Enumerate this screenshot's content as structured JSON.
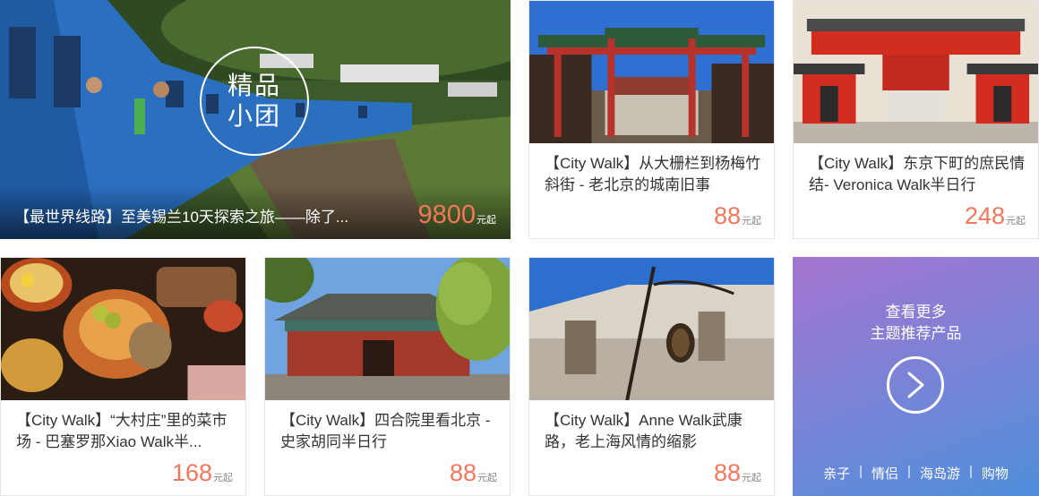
{
  "featured": {
    "badge_line1": "精品",
    "badge_line2": "小团",
    "title": "【最世界线路】至美锡兰10天探索之旅——除了...",
    "price": "9800",
    "unit": "元起"
  },
  "cards": [
    {
      "title": "【City Walk】从大栅栏到杨梅竹斜街 - 老北京的城南旧事",
      "price": "88",
      "unit": "元起"
    },
    {
      "title": "【City Walk】东京下町的庶民情结- Veronica Walk半日行",
      "price": "248",
      "unit": "元起"
    },
    {
      "title": "【City Walk】“大村庄”里的菜市场 - 巴塞罗那Xiao Walk半...",
      "price": "168",
      "unit": "元起"
    },
    {
      "title": "【City Walk】四合院里看北京 - 史家胡同半日行",
      "price": "88",
      "unit": "元起"
    },
    {
      "title": "【City Walk】Anne Walk武康路，老上海风情的缩影",
      "price": "88",
      "unit": "元起"
    }
  ],
  "more": {
    "line1": "查看更多",
    "line2": "主题推荐产品",
    "tags": [
      "亲子",
      "情侣",
      "海岛游",
      "购物"
    ],
    "separator": "|"
  }
}
